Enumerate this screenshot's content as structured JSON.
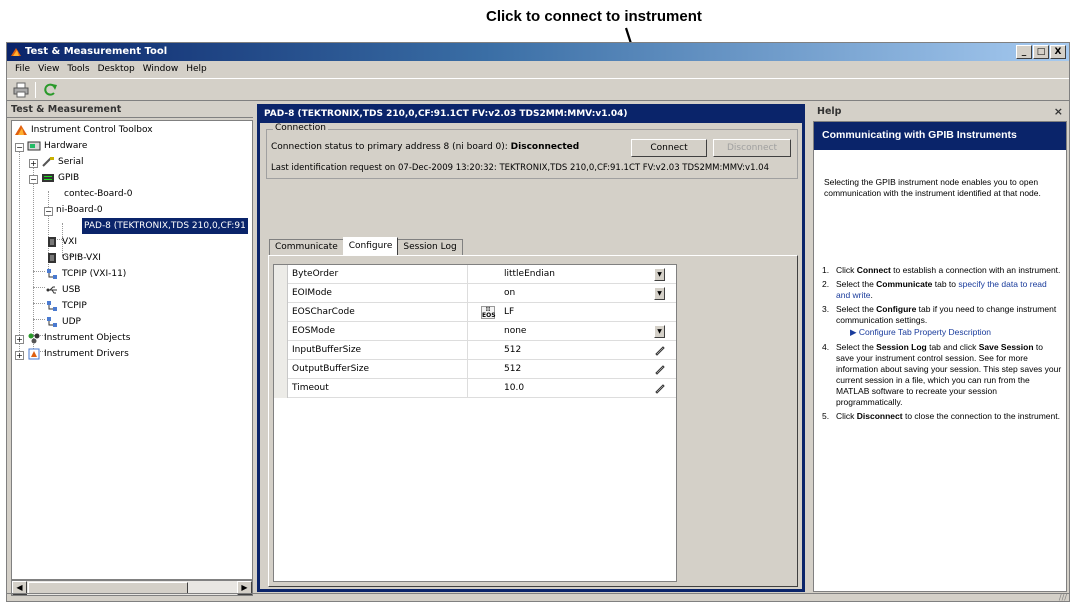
{
  "annotation": {
    "callout": "Click to connect to instrument"
  },
  "window": {
    "title": "Test & Measurement Tool",
    "controls": {
      "minimize": "_",
      "maximize": "□",
      "close": "X"
    }
  },
  "menu": [
    "File",
    "View",
    "Tools",
    "Desktop",
    "Window",
    "Help"
  ],
  "toolbar": {
    "icons": [
      "print-icon",
      "refresh-icon"
    ]
  },
  "left_panel": {
    "header": "Test & Measurement",
    "tree": [
      {
        "label": "Instrument Control Toolbox",
        "icon": "toolbox-icon"
      },
      {
        "label": "Hardware",
        "icon": "hardware-icon",
        "expander": "−"
      },
      {
        "label": "Serial",
        "icon": "serial-icon",
        "expander": "+"
      },
      {
        "label": "GPIB",
        "icon": "gpib-icon",
        "expander": "−"
      },
      {
        "label": "contec-Board-0"
      },
      {
        "label": "ni-Board-0",
        "expander": "−"
      },
      {
        "label": "PAD-8 (TEKTRONIX,TDS 210,0,CF:91",
        "selected": true
      },
      {
        "label": "VXI",
        "icon": "vxi-icon"
      },
      {
        "label": "GPIB-VXI",
        "icon": "gpib-vxi-icon"
      },
      {
        "label": "TCPIP (VXI-11)",
        "icon": "tcpip-icon"
      },
      {
        "label": "USB",
        "icon": "usb-icon"
      },
      {
        "label": "TCPIP",
        "icon": "tcpip-icon"
      },
      {
        "label": "UDP",
        "icon": "udp-icon"
      },
      {
        "label": "Instrument Objects",
        "icon": "objects-icon",
        "expander": "+"
      },
      {
        "label": "Instrument Drivers",
        "icon": "drivers-icon",
        "expander": "+"
      }
    ]
  },
  "middle_panel": {
    "title": "PAD-8 (TEKTRONIX,TDS 210,0,CF:91.1CT FV:v2.03 TDS2MM:MMV:v1.04)",
    "connection": {
      "legend": "Connection",
      "status_prefix": "Connection status to primary address 8 (ni board 0): ",
      "status_value": "Disconnected",
      "identification": "Last identification request on 07-Dec-2009 13:20:32: TEKTRONIX,TDS 210,0,CF:91.1CT FV:v2.03 TDS2MM:MMV:v1.04",
      "connect_label": "Connect",
      "disconnect_label": "Disconnect"
    },
    "tabs": [
      "Communicate",
      "Configure",
      "Session Log"
    ],
    "active_tab": "Configure",
    "properties": [
      {
        "name": "ByteOrder",
        "value": "littleEndian",
        "editor": "dropdown"
      },
      {
        "name": "EOIMode",
        "value": "on",
        "editor": "dropdown"
      },
      {
        "name": "EOSCharCode",
        "value": "LF",
        "editor": "eos"
      },
      {
        "name": "EOSMode",
        "value": "none",
        "editor": "dropdown"
      },
      {
        "name": "InputBufferSize",
        "value": "512",
        "editor": "pencil"
      },
      {
        "name": "OutputBufferSize",
        "value": "512",
        "editor": "pencil"
      },
      {
        "name": "Timeout",
        "value": "10.0",
        "editor": "pencil"
      }
    ],
    "eos_glyph": {
      "top": "⁝⁝",
      "bottom": "EOS"
    }
  },
  "help_panel": {
    "header": "Help",
    "close": "×",
    "title": "Communicating with GPIB Instruments",
    "intro": "Selecting the GPIB instrument node enables you to open communication with the instrument identified at that node.",
    "steps": [
      {
        "num": "1.",
        "a": "Click ",
        "b": "Connect",
        "c": " to establish a connection with an instrument."
      },
      {
        "num": "2.",
        "a": "Select the ",
        "b": "Communicate",
        "c": " tab to ",
        "link": "specify the data to read and write",
        "d": "."
      },
      {
        "num": "3.",
        "a": "Select the ",
        "b": "Configure",
        "c": " tab if you need to change instrument communication settings.",
        "sublink": "Configure Tab Property Description"
      },
      {
        "num": "4.",
        "a": "Select the ",
        "b": "Session Log",
        "c": " tab and click ",
        "b2": "Save Session",
        "d": " to save your instrument control session. See for more information about saving your session. This step saves your current session in a file, which you can run from the MATLAB software to recreate your session programmatically."
      },
      {
        "num": "5.",
        "a": "Click ",
        "b": "Disconnect",
        "c": " to close the connection to the instrument."
      }
    ]
  },
  "colors": {
    "title_active": "#0a246a",
    "face": "#d4d0c8",
    "link": "#1a3c9c"
  }
}
